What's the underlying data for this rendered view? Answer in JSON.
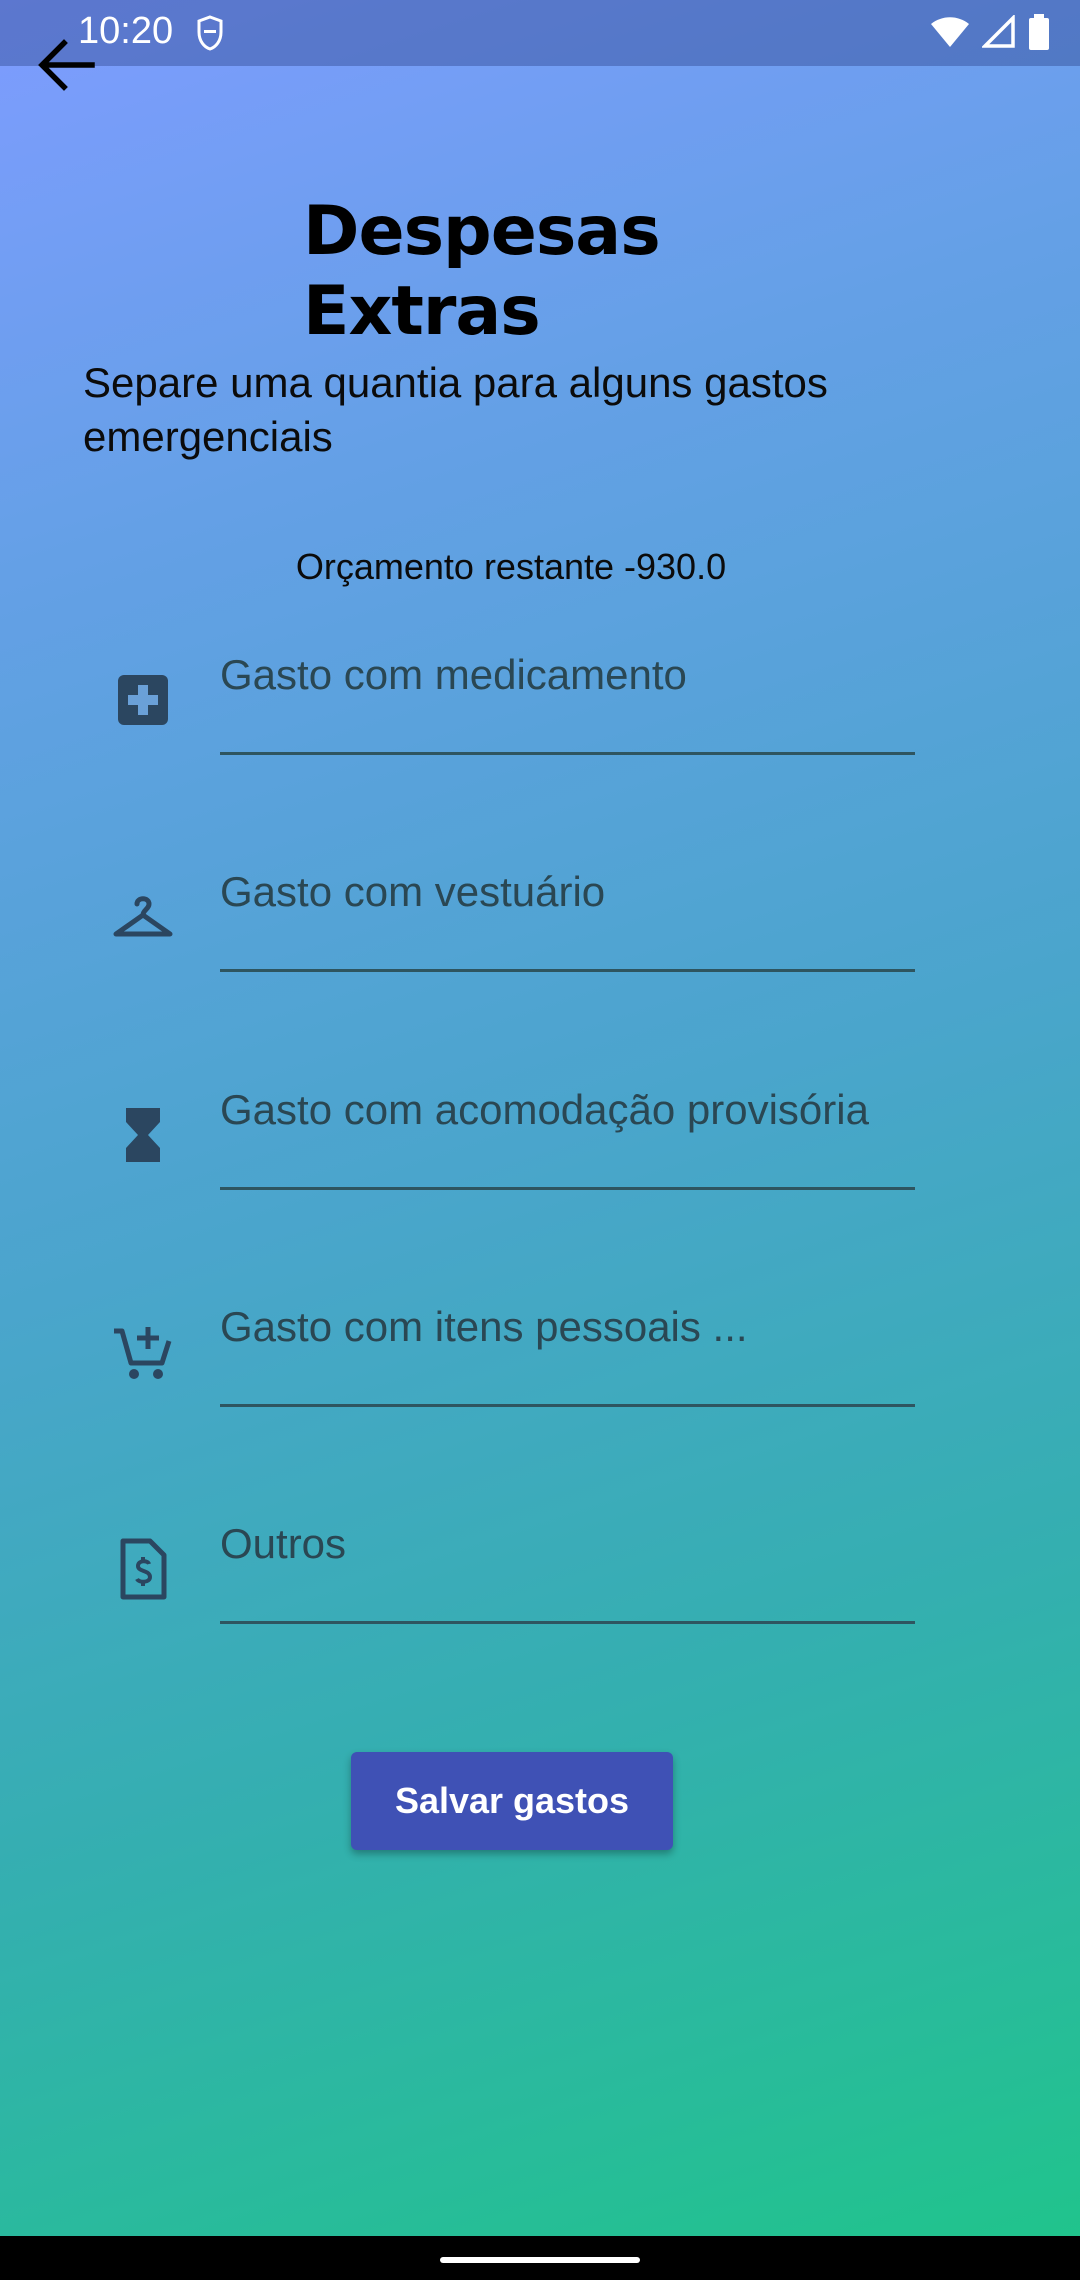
{
  "status_bar": {
    "time": "10:20"
  },
  "header": {
    "title": "Despesas\nExtras",
    "subtitle": "Separe uma quantia para alguns gastos emergenciais"
  },
  "budget": {
    "text": "Orçamento restante -930.0"
  },
  "fields": [
    {
      "placeholder": "Gasto com medicamento",
      "icon": "medical-cross-icon"
    },
    {
      "placeholder": "Gasto com vestuário",
      "icon": "hanger-icon"
    },
    {
      "placeholder": "Gasto com acomodação provisória",
      "icon": "hourglass-icon"
    },
    {
      "placeholder": "Gasto com itens pessoais ...",
      "icon": "add-cart-icon"
    },
    {
      "placeholder": "Outros",
      "icon": "invoice-icon"
    }
  ],
  "actions": {
    "save_label": "Salvar gastos"
  },
  "colors": {
    "button": "#3f51b5",
    "gradient_top": "#7e9cff",
    "gradient_bottom": "#1fc58a"
  }
}
